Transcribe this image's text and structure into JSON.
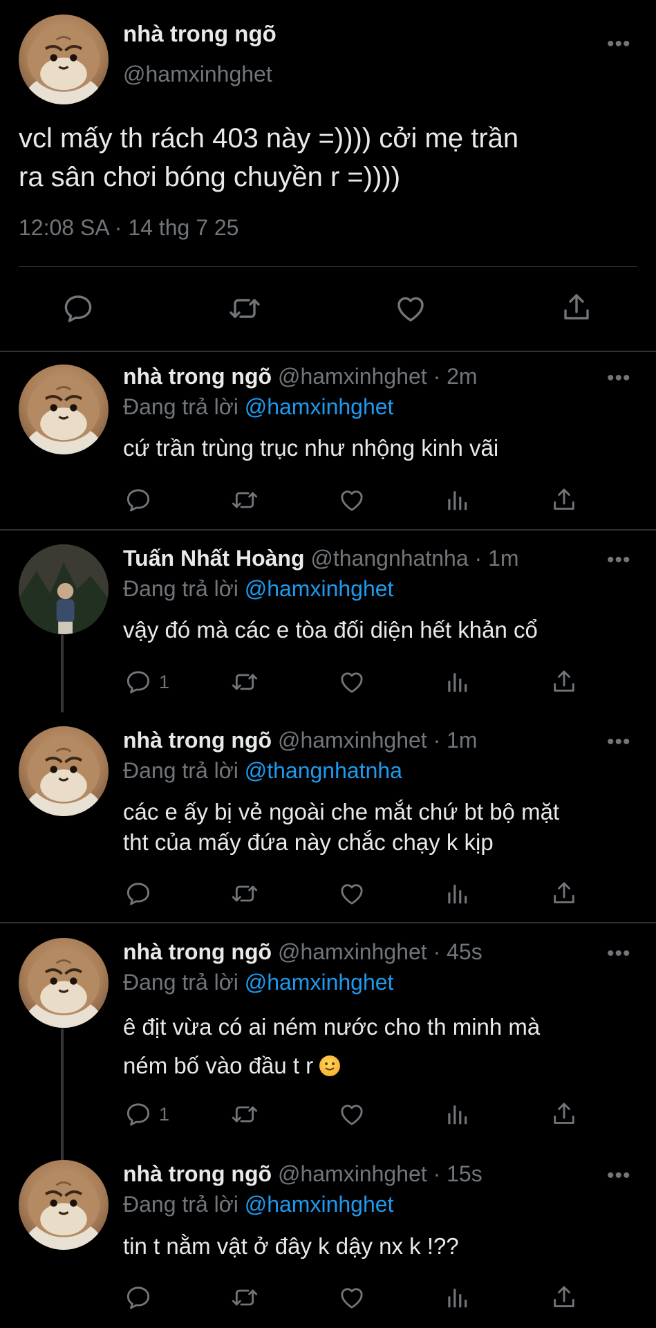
{
  "main_tweet": {
    "name": "nhà trong ngõ",
    "handle": "@hamxinhghet",
    "text_line1": "vcl mấy th rách 403 này =)))) cởi mẹ trần",
    "text_line2": "ra sân chơi bóng chuyền r =))))",
    "meta": "12:08 SA · 14 thg 7 25",
    "icons": [
      "reply-icon",
      "retweet-icon",
      "like-icon",
      "share-icon"
    ]
  },
  "replies": [
    {
      "name": "nhà trong ngõ",
      "handle_time": "@hamxinhghet · 2m",
      "reply_prefix": "Đang trả lời",
      "reply_to": "@hamxinhghet",
      "text_line1": "cứ trần trùng trục như nhộng kinh vãi",
      "text_line2": "",
      "reply_count": ""
    },
    {
      "name": "Tuấn Nhất Hoàng",
      "handle_time": "@thangnhatnha · 1m",
      "reply_prefix": "Đang trả lời",
      "reply_to": "@hamxinhghet",
      "text_line1": "vậy đó mà các e tòa đối diện hết khản cổ",
      "text_line2": "",
      "reply_count": "1"
    },
    {
      "name": "nhà trong ngõ",
      "handle_time": "@hamxinhghet · 1m",
      "reply_prefix": "Đang trả lời",
      "reply_to": "@thangnhatnha",
      "text_line1": "các e ấy bị vẻ ngoài che mắt chứ bt bộ mặt",
      "text_line2": "tht của mấy đứa này chắc chạy k kịp",
      "reply_count": ""
    },
    {
      "name": "nhà trong ngõ",
      "handle_time": "@hamxinhghet · 45s",
      "reply_prefix": "Đang trả lời",
      "reply_to": "@hamxinhghet",
      "text_line1": "ê địt vừa có ai ném nước cho th minh mà",
      "text_line2": "ném bố vào đầu t r",
      "emoji": "slightly-smiling-face",
      "reply_count": "1"
    },
    {
      "name": "nhà trong ngõ",
      "handle_time": "@hamxinhghet · 15s",
      "reply_prefix": "Đang trả lời",
      "reply_to": "@hamxinhghet",
      "text_line1": "tin t nằm vật ở đây k dậy nx k !??",
      "text_line2": "",
      "reply_count": ""
    }
  ],
  "more_label": "•••",
  "colors": {
    "background": "#000000",
    "text": "#e7e9ea",
    "secondary": "#71767b",
    "mention": "#1d9bf0",
    "divider": "#2f3336"
  }
}
